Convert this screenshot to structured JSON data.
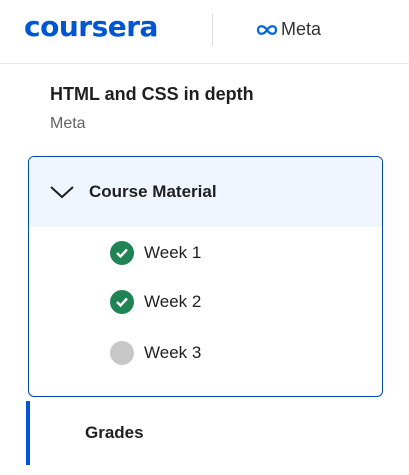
{
  "header": {
    "logo_text": "coursera",
    "partner_name": "Meta"
  },
  "course": {
    "title": "HTML and CSS in depth",
    "provider": "Meta"
  },
  "material": {
    "label": "Course Material",
    "weeks": [
      {
        "label": "Week 1",
        "status": "completed"
      },
      {
        "label": "Week 2",
        "status": "completed"
      },
      {
        "label": "Week 3",
        "status": "not-started"
      }
    ]
  },
  "nav": {
    "grades_label": "Grades"
  },
  "colors": {
    "brand": "#0056d2",
    "completed": "#1f8354",
    "incomplete": "#c7c7c7",
    "selected_bg": "#f0f6ff"
  }
}
